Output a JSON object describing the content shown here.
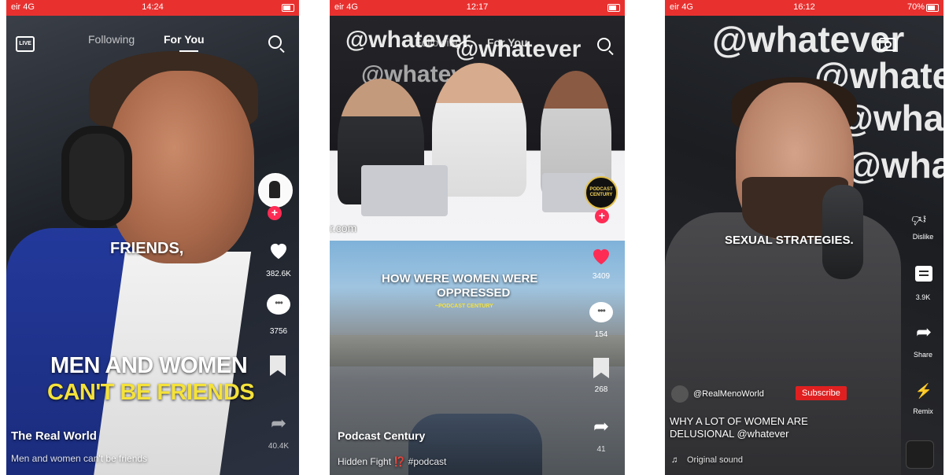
{
  "colors": {
    "status_bar": "#e8312f",
    "like_red": "#fe2c55",
    "subscribe_red": "#e02020",
    "caption_yellow": "#f5e23a"
  },
  "phone1": {
    "status": {
      "carrier": "eir 4G",
      "time": "14:24"
    },
    "nav": {
      "following": "Following",
      "for_you": "For You",
      "live_icon": "LIVE"
    },
    "overlay": {
      "friends": "FRIENDS,",
      "line1": "MEN AND WOMEN",
      "line2": "CAN'T BE FRIENDS"
    },
    "counts": {
      "likes": "382.6K",
      "comments": "3756",
      "shares": "40.4K"
    },
    "author": "The Real World",
    "caption": "Men and women can't be friends"
  },
  "phone2": {
    "status": {
      "carrier": "eir 4G",
      "time": "12:17"
    },
    "nav": {
      "following": "Following",
      "for_you": "For You"
    },
    "wall_text": "@whatever",
    "overlay": {
      "line1": "HOW WERE WOMEN WERE",
      "line2": "OPPRESSED",
      "tag": "~PODCAST CENTURY"
    },
    "avatar_badge": "PODCAST CENTURY",
    "watermark": "r.com",
    "counts": {
      "likes": "3409",
      "comments": "154",
      "saves": "268",
      "shares": "41"
    },
    "author": "Podcast Century",
    "caption": "Hidden Fight ⁉️ #podcast"
  },
  "phone3": {
    "status": {
      "carrier": "eir 4G",
      "time": "16:12",
      "battery": "70%"
    },
    "wall_text": "@whatever",
    "overlay": {
      "line1": "SEXUAL STRATEGIES."
    },
    "side": {
      "dislike": "Dislike",
      "comments": "3.9K",
      "share": "Share",
      "remix": "Remix"
    },
    "channel": "@RealMenoWorld",
    "subscribe": "Subscribe",
    "title": "WHY A LOT OF WOMEN ARE DELUSIONAL @whatever",
    "sound": "Original sound"
  },
  "icons": [
    "live-icon",
    "search-icon",
    "heart-icon",
    "comment-icon",
    "bookmark-icon",
    "share-icon",
    "camera-icon",
    "music-note-icon",
    "thumbs-down-icon",
    "remix-icon"
  ]
}
